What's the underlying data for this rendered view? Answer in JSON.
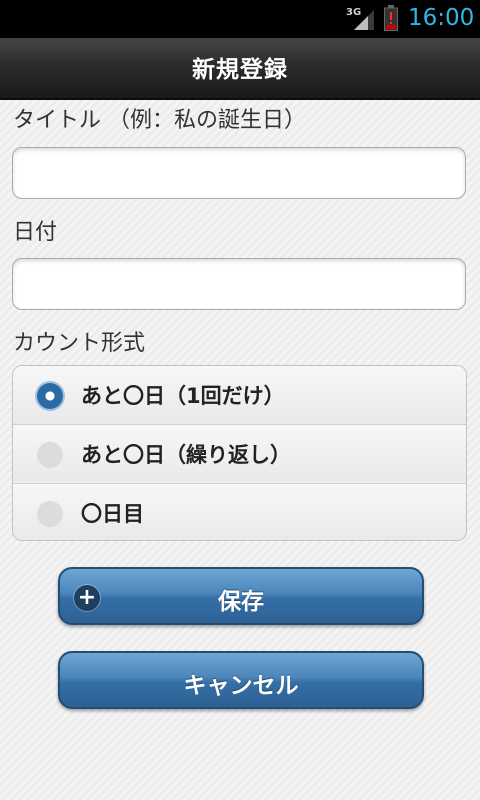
{
  "status_bar": {
    "network": "3G",
    "time": "16:00"
  },
  "header": {
    "title": "新規登録"
  },
  "form": {
    "title_label": "タイトル （例：私の誕生日）",
    "title_value": "",
    "date_label": "日付",
    "date_value": "",
    "count_label": "カウント形式",
    "count_options": [
      {
        "label": "あと〇日（1回だけ）",
        "selected": true
      },
      {
        "label": "あと〇日（繰り返し）",
        "selected": false
      },
      {
        "label": "〇日目",
        "selected": false
      }
    ]
  },
  "buttons": {
    "save": "保存",
    "cancel": "キャンセル"
  }
}
